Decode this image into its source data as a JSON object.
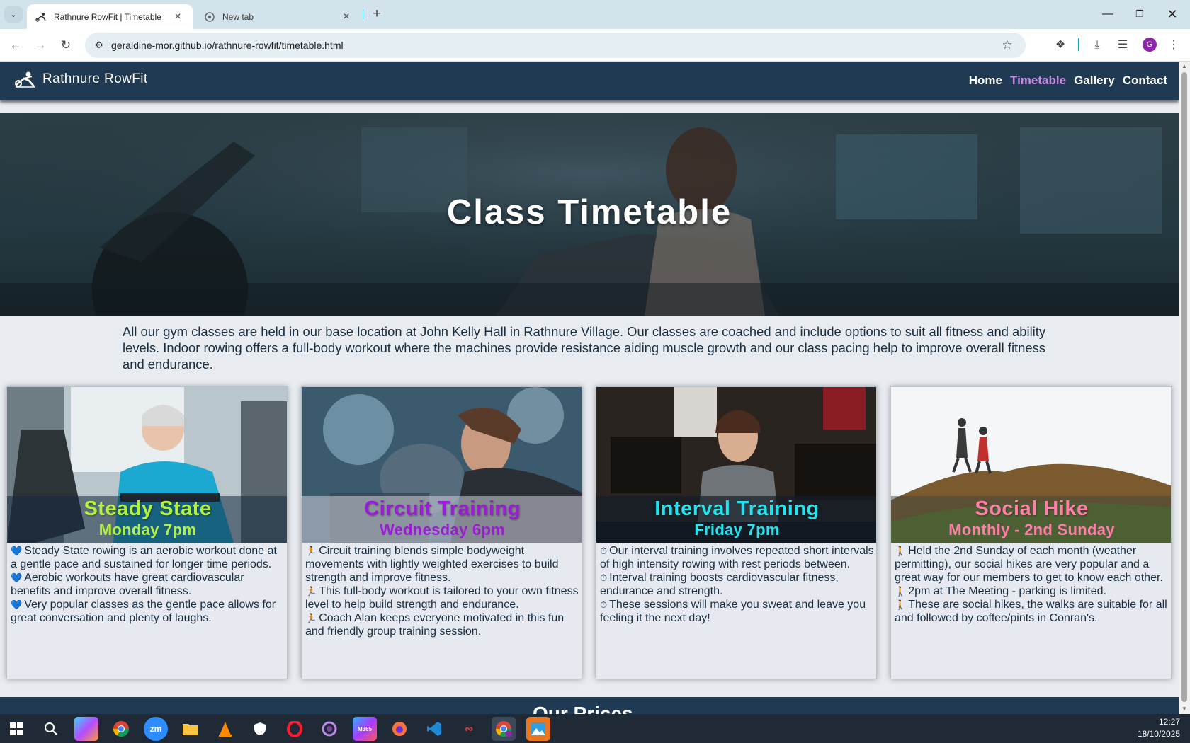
{
  "browser": {
    "tab_menu_icon": "chevron-down-icon",
    "tabs": [
      {
        "title": "Rathnure RowFit | Timetable",
        "icon": "rower-icon"
      },
      {
        "title": "New tab",
        "icon": "chrome-icon"
      }
    ],
    "url": "geraldine-mor.github.io/rathnure-rowfit/timetable.html",
    "profile_initial": "G"
  },
  "site": {
    "brand": "Rathnure RowFit",
    "nav": [
      "Home",
      "Timetable",
      "Gallery",
      "Contact"
    ],
    "active_nav": "Timetable",
    "hero_title": "Class Timetable",
    "intro": "All our gym classes are held in our base location at John Kelly Hall in Rathnure Village. Our classes are coached and include options to suit all fitness and ability levels. Indoor rowing offers a full-body workout where the machines provide resistance aiding muscle growth and our class pacing help to improve overall fitness and endurance.",
    "classes": [
      {
        "name": "Steady State",
        "time": "Monday 7pm",
        "color": "#b4f040",
        "icon": "heart-icon",
        "glyph": "💙",
        "points": [
          "Steady State rowing is an aerobic workout done at a gentle pace and sustained for longer time periods.",
          "Aerobic workouts have great cardiovascular benefits and improve overall fitness.",
          "Very popular classes as the gentle pace allows for great conversation and plenty of laughs."
        ]
      },
      {
        "name": "Circuit Training",
        "time": "Wednesday 6pm",
        "color": "#9c1bd6",
        "icon": "runner-icon",
        "glyph": "🏃",
        "points": [
          "Circuit training blends simple bodyweight movements with lightly weighted exercises to build strength and improve fitness.",
          "This full-body workout is tailored to your own fitness level to help build strength and endurance.",
          "Coach Alan keeps everyone motivated in this fun and friendly group training session."
        ]
      },
      {
        "name": "Interval Training",
        "time": "Friday 7pm",
        "color": "#22e4ef",
        "icon": "stopwatch-icon",
        "glyph": "⏱",
        "points": [
          "Our interval training involves repeated short intervals of high intensity rowing with rest periods between.",
          "Interval training boosts cardiovascular fitness, endurance and strength.",
          "These sessions will make you sweat and leave you feeling it the next day!"
        ]
      },
      {
        "name": "Social Hike",
        "time": "Monthly - 2nd Sunday",
        "color": "#ff7fa8",
        "icon": "hiker-icon",
        "glyph": "🚶",
        "points": [
          "Held the 2nd Sunday of each month (weather permitting), our social hikes are very popular and a great way for our members to get to know each other.",
          "2pm at The Meeting - parking is limited.",
          "These are social hikes, the walks are suitable for all and followed by coffee/pints in Conran's."
        ]
      }
    ],
    "footer_partial": "Our Prices"
  },
  "taskbar": {
    "apps": [
      "start-icon",
      "search-icon",
      "copilot-icon",
      "chrome-icon",
      "zoom-icon",
      "file-explorer-icon",
      "vlc-icon",
      "security-icon",
      "opera-icon",
      "tor-icon",
      "m365-icon",
      "firefox-icon",
      "vscode-icon",
      "acrobat-icon",
      "chrome-profile-icon",
      "photos-icon"
    ],
    "time": "12:27",
    "date": "18/10/2025"
  }
}
